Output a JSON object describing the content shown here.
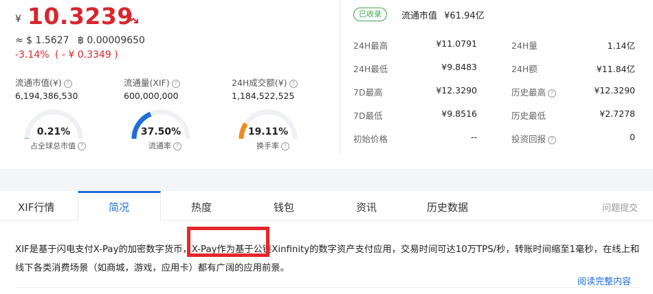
{
  "price": {
    "currency_symbol": "¥",
    "value": "10.3239",
    "trend_icon": "trend-down-icon",
    "usd": "≈ $ 1.5627",
    "btc": "฿ 0.00009650",
    "change_pct": "-3.14%",
    "change_abs": "( - ¥ 0.3349 )",
    "color_down": "#d7262c"
  },
  "stats": [
    {
      "label": "流通市值(¥)",
      "value": "6,194,386,530",
      "gauge_value": "0.21%",
      "gauge_label": "占全球总市值",
      "gauge_fraction": 0.0021,
      "gauge_color": "#1e6fd9"
    },
    {
      "label": "流通量(XIF)",
      "value": "600,000,000",
      "gauge_value": "37.50%",
      "gauge_label": "流通率",
      "gauge_fraction": 0.375,
      "gauge_color": "#1e6fd9"
    },
    {
      "label": "24H成交额(¥)",
      "value": "1,184,522,525",
      "gauge_value": "19.11%",
      "gauge_label": "换手率",
      "gauge_fraction": 0.1911,
      "gauge_color": "#f08a24"
    }
  ],
  "right": {
    "badge": "已收录",
    "market_cap_label": "流通市值",
    "market_cap_value": "¥61.94亿",
    "rows": [
      {
        "l1": "24H最高",
        "v1": "¥11.0791",
        "l2": "24H量",
        "v2": "1.14亿"
      },
      {
        "l1": "24H最低",
        "v1": "¥9.8483",
        "l2": "24H额",
        "v2": "¥11.84亿"
      },
      {
        "l1": "7D最高",
        "v1": "¥12.3290",
        "l2": "历史最高",
        "v2": "¥12.3290"
      },
      {
        "l1": "7D最低",
        "v1": "¥9.8516",
        "l2": "历史最低",
        "v2": "¥2.7278"
      },
      {
        "l1": "初始价格",
        "v1": "--",
        "l2": "投资回报",
        "v2": "0"
      }
    ]
  },
  "tabs": [
    {
      "label": "XIF行情",
      "active": false
    },
    {
      "label": "简况",
      "active": true
    },
    {
      "label": "热度",
      "active": false
    },
    {
      "label": "钱包",
      "active": false
    },
    {
      "label": "资讯",
      "active": false
    },
    {
      "label": "历史数据",
      "active": false
    }
  ],
  "feedback": "问题提交",
  "description": "XIF是基于闪电支付X-Pay的加密数字货币，X-Pay作为基于公链Xinfinity的数字资产支付应用，交易时间可达10万TPS/秒，转账时间缩至1毫秒，在线上和线下各类消费场景（如商城，游戏，应用卡）都有广阔的应用前景。",
  "read_more": "阅读完整内容"
}
